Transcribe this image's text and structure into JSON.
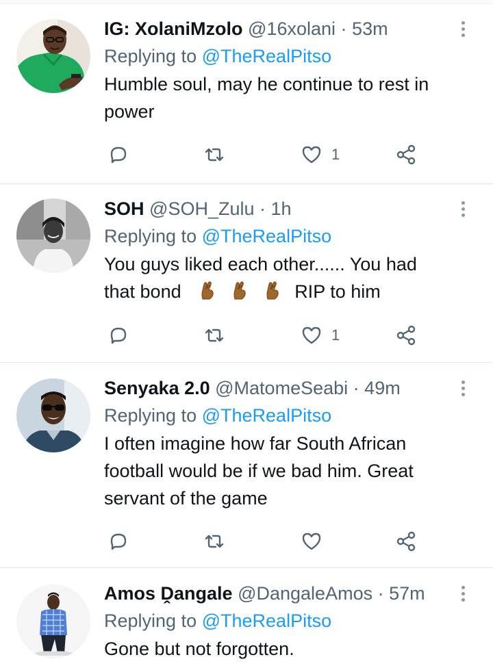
{
  "tweets": [
    {
      "display_name": "IG: XolaniMzolo",
      "handle": "@16xolani",
      "separator": "·",
      "time": "53m",
      "replying_prefix": "Replying to",
      "replying_to": "@TheRealPitso",
      "text_lines": [
        "Humble soul, may he continue to rest in",
        "power"
      ],
      "like_count": "1",
      "avatar": "man-green-shirt-avatar"
    },
    {
      "display_name": "SOH",
      "handle": "@SOH_Zulu",
      "separator": "·",
      "time": "1h",
      "replying_prefix": "Replying to",
      "replying_to": "@TheRealPitso",
      "text_line1": "You guys liked each other...... You had",
      "text_line2_start": "that bond",
      "emoji": "crossed-fingers",
      "text_line2_end": "RIP to him",
      "like_count": "1",
      "avatar": "woman-monochrome-avatar"
    },
    {
      "display_name": "Senyaka 2.0",
      "handle": "@MatomeSeabi",
      "separator": "·",
      "time": "49m",
      "replying_prefix": "Replying to",
      "replying_to": "@TheRealPitso",
      "text_lines": [
        "I often imagine how far South African",
        "football would be if we bad him. Great",
        "servant of the game"
      ],
      "like_count": "",
      "avatar": "man-sunglasses-avatar"
    },
    {
      "display_name": "Amos Ḓangale",
      "handle": "@DangaleAmos",
      "separator": "·",
      "time": "57m",
      "replying_prefix": "Replying to",
      "replying_to": "@TheRealPitso",
      "text_lines": [
        "Gone but not forgotten."
      ],
      "avatar": "man-checked-shirt-avatar"
    }
  ],
  "colors": {
    "text": "#0f1419",
    "secondary": "#536471",
    "link": "#1d9bf0",
    "divider": "#e1e8ed",
    "icon": "#536471"
  }
}
